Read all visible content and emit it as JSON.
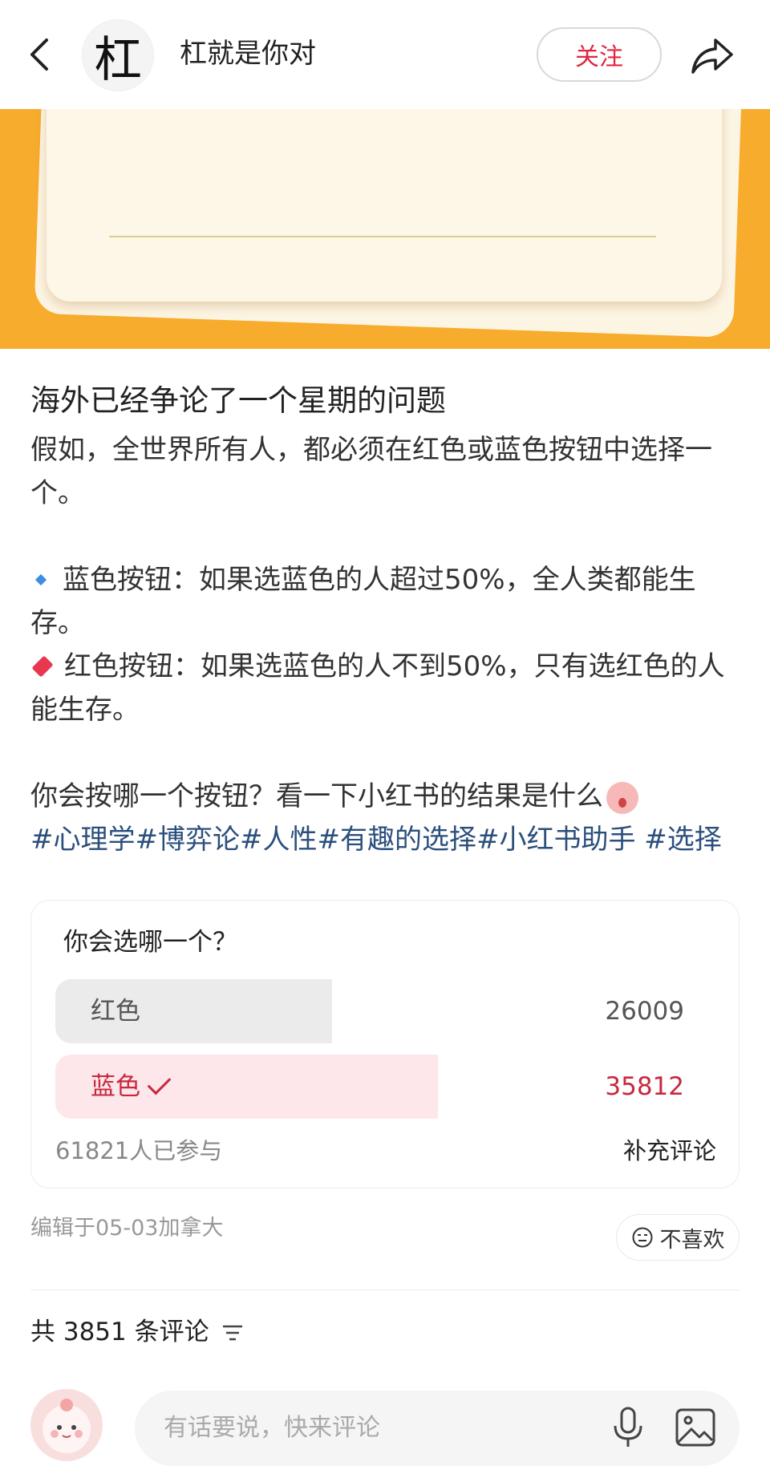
{
  "header": {
    "author_avatar_text": "杠",
    "author_name": "杠就是你对",
    "follow_label": "关注"
  },
  "post": {
    "title": "海外已经争论了一个星期的问题",
    "intro": "假如，全世界所有人，都必须在红色或蓝色按钮中选择一个。",
    "blue_rule": "蓝色按钮：如果选蓝色的人超过50%，全人类都能生存。",
    "red_rule": "红色按钮：如果选蓝色的人不到50%，只有选红色的人能生存。",
    "question": "你会按哪一个按钮？看一下小红书的结果是什么",
    "tags": "#心理学#博弈论#人性#有趣的选择#小红书助手 #选择"
  },
  "poll": {
    "question": "你会选哪一个？",
    "options": [
      {
        "label": "红色",
        "votes": "26009",
        "fraction": 0.42,
        "selected": false
      },
      {
        "label": "蓝色",
        "votes": "35812",
        "fraction": 0.58,
        "selected": true
      }
    ],
    "participants": "61821人已参与",
    "supplement_label": "补充评论"
  },
  "meta": {
    "edited": "编辑于05-03加拿大",
    "dislike_label": "不喜欢"
  },
  "comments": {
    "count_label": "共 3851 条评论"
  },
  "composer": {
    "placeholder": "有话要说，快来评论"
  },
  "colors": {
    "brand_red": "#e0263f",
    "banner_orange": "#f8ac2d",
    "tag_blue": "#2b4f7c"
  },
  "icons": [
    "back-icon",
    "share-icon",
    "blue-diamond-icon",
    "red-diamond-icon",
    "emoji-icon",
    "check-icon",
    "dislike-face-icon",
    "sort-icon",
    "mic-icon",
    "image-icon"
  ]
}
